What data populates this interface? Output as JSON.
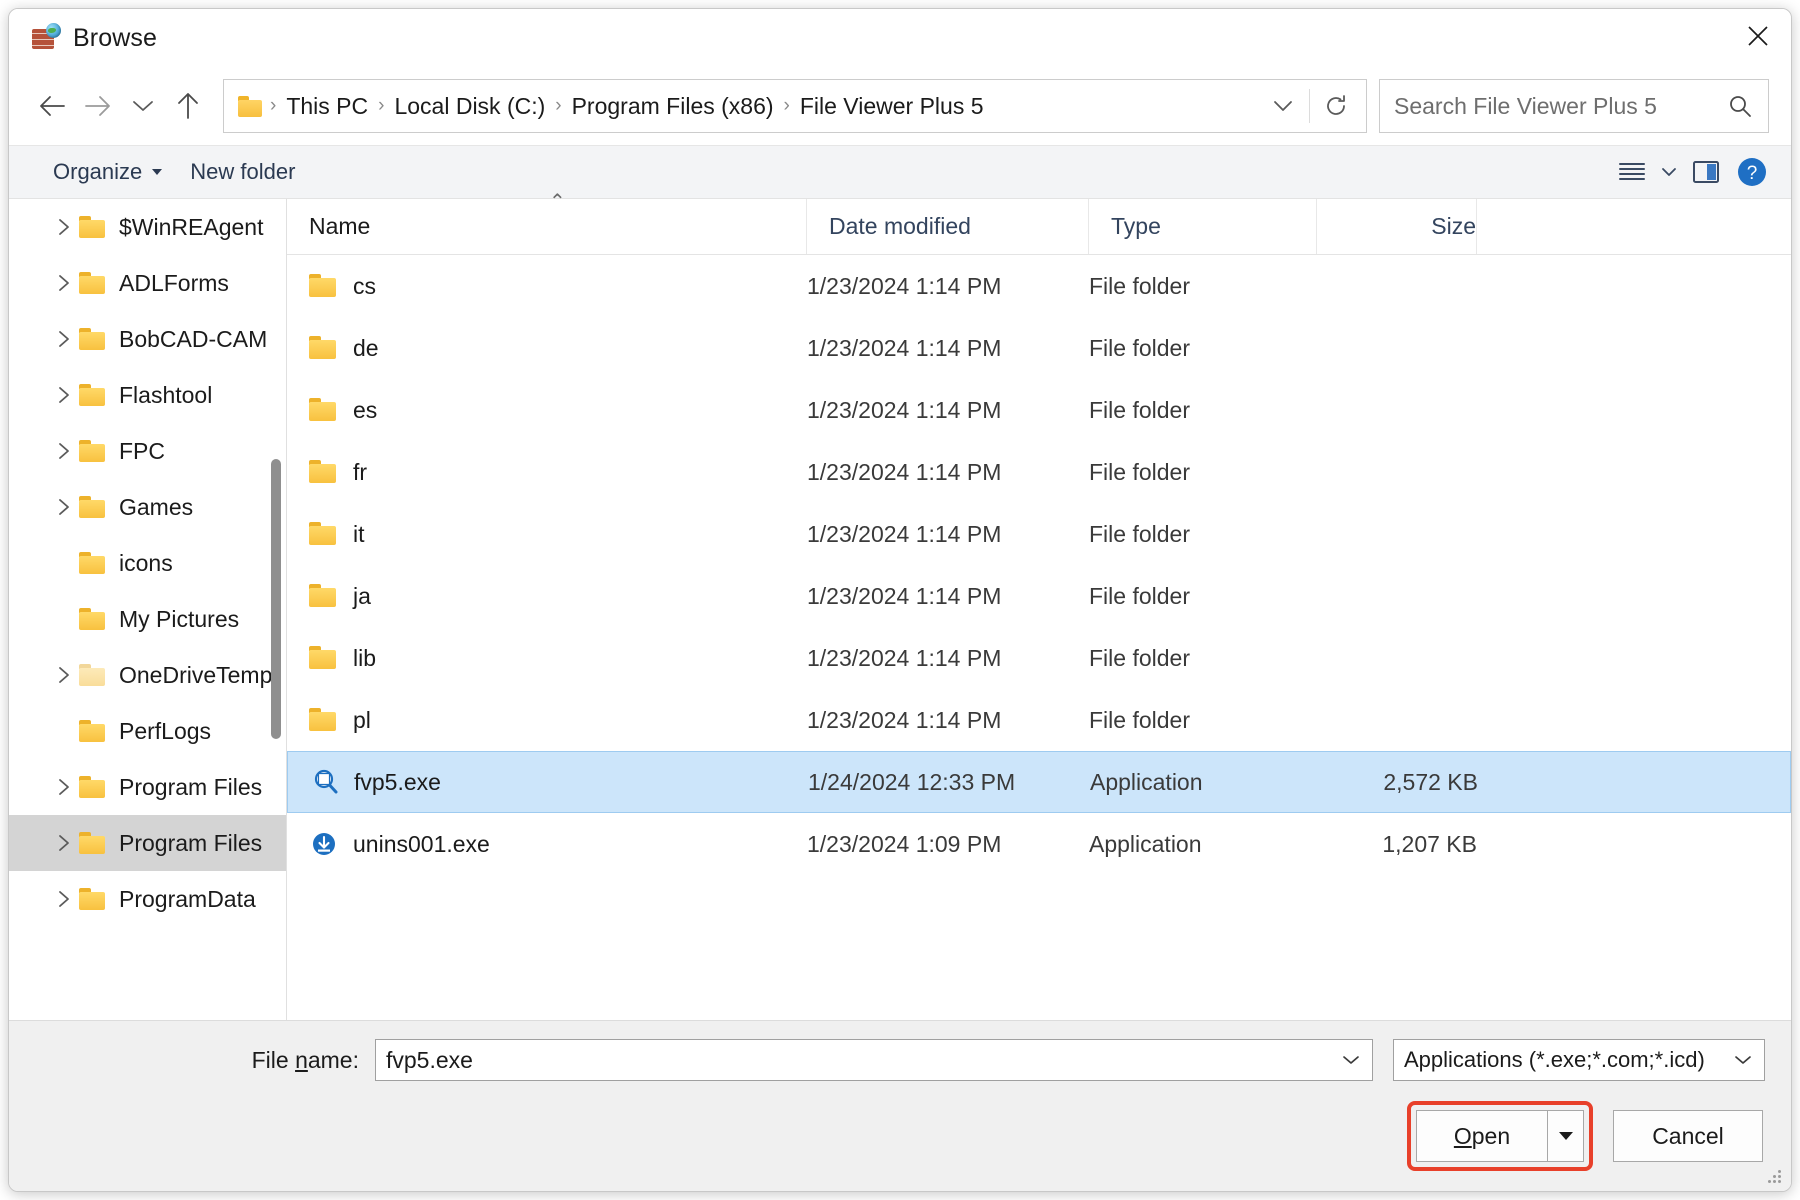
{
  "window": {
    "title": "Browse",
    "title_icon": "firewall-globe-icon",
    "close_label": "✕"
  },
  "nav": {
    "back_icon": "arrow-left-icon",
    "forward_icon": "arrow-right-icon",
    "recent_icon": "chevron-down-icon",
    "up_icon": "arrow-up-icon",
    "address": {
      "folder_icon": "folder-icon",
      "crumbs": [
        "This PC",
        "Local Disk (C:)",
        "Program Files (x86)",
        "File Viewer Plus 5"
      ],
      "separator": "›",
      "dropdown_icon": "chevron-down-icon",
      "refresh_icon": "refresh-icon"
    },
    "search": {
      "placeholder": "Search File Viewer Plus 5",
      "value": "",
      "icon": "search-icon"
    }
  },
  "toolbar": {
    "organize_label": "Organize",
    "new_folder_label": "New folder",
    "view_icon": "list-view-icon",
    "view_caret_icon": "chevron-down-icon",
    "preview_pane_icon": "preview-pane-icon",
    "help_icon": "help-icon",
    "help_label": "?"
  },
  "sidebar": {
    "items": [
      {
        "label": "$WinREAgent",
        "expander": true,
        "pale": false,
        "selected": false
      },
      {
        "label": "ADLForms",
        "expander": true,
        "pale": false,
        "selected": false
      },
      {
        "label": "BobCAD-CAM",
        "expander": true,
        "pale": false,
        "selected": false
      },
      {
        "label": "Flashtool",
        "expander": true,
        "pale": false,
        "selected": false
      },
      {
        "label": "FPC",
        "expander": true,
        "pale": false,
        "selected": false
      },
      {
        "label": "Games",
        "expander": true,
        "pale": false,
        "selected": false
      },
      {
        "label": "icons",
        "expander": false,
        "pale": false,
        "selected": false
      },
      {
        "label": "My Pictures",
        "expander": false,
        "pale": false,
        "selected": false
      },
      {
        "label": "OneDriveTemp",
        "expander": true,
        "pale": true,
        "selected": false
      },
      {
        "label": "PerfLogs",
        "expander": false,
        "pale": false,
        "selected": false
      },
      {
        "label": "Program Files",
        "expander": true,
        "pale": false,
        "selected": false
      },
      {
        "label": "Program Files",
        "expander": true,
        "pale": false,
        "selected": true
      },
      {
        "label": "ProgramData",
        "expander": true,
        "pale": false,
        "selected": false
      }
    ]
  },
  "filelist": {
    "columns": [
      "Name",
      "Date modified",
      "Type",
      "Size"
    ],
    "sort_column": "Name",
    "sort_indicator": "⌃",
    "rows": [
      {
        "name": "cs",
        "date": "1/23/2024 1:14 PM",
        "type": "File folder",
        "size": "",
        "icon": "folder-icon",
        "selected": false
      },
      {
        "name": "de",
        "date": "1/23/2024 1:14 PM",
        "type": "File folder",
        "size": "",
        "icon": "folder-icon",
        "selected": false
      },
      {
        "name": "es",
        "date": "1/23/2024 1:14 PM",
        "type": "File folder",
        "size": "",
        "icon": "folder-icon",
        "selected": false
      },
      {
        "name": "fr",
        "date": "1/23/2024 1:14 PM",
        "type": "File folder",
        "size": "",
        "icon": "folder-icon",
        "selected": false
      },
      {
        "name": "it",
        "date": "1/23/2024 1:14 PM",
        "type": "File folder",
        "size": "",
        "icon": "folder-icon",
        "selected": false
      },
      {
        "name": "ja",
        "date": "1/23/2024 1:14 PM",
        "type": "File folder",
        "size": "",
        "icon": "folder-icon",
        "selected": false
      },
      {
        "name": "lib",
        "date": "1/23/2024 1:14 PM",
        "type": "File folder",
        "size": "",
        "icon": "folder-icon",
        "selected": false
      },
      {
        "name": "pl",
        "date": "1/23/2024 1:14 PM",
        "type": "File folder",
        "size": "",
        "icon": "folder-icon",
        "selected": false
      },
      {
        "name": "fvp5.exe",
        "date": "1/24/2024 12:33 PM",
        "type": "Application",
        "size": "2,572 KB",
        "icon": "magnifier-app-icon",
        "selected": true
      },
      {
        "name": "unins001.exe",
        "date": "1/23/2024 1:09 PM",
        "type": "Application",
        "size": "1,207 KB",
        "icon": "uninstall-app-icon",
        "selected": false
      }
    ]
  },
  "footer": {
    "filename_label_before": "File ",
    "filename_label_accel": "n",
    "filename_label_after": "ame:",
    "filename_value": "fvp5.exe",
    "filename_placeholder": "",
    "filename_caret_icon": "chevron-down-icon",
    "filter_value": "Applications (*.exe;*.com;*.icd)",
    "filter_caret_icon": "chevron-down-icon",
    "open_label_before": "",
    "open_label_accel": "O",
    "open_label_after": "pen",
    "open_split_icon": "chevron-down-icon",
    "cancel_label": "Cancel",
    "highlight_color": "#e8402a"
  }
}
